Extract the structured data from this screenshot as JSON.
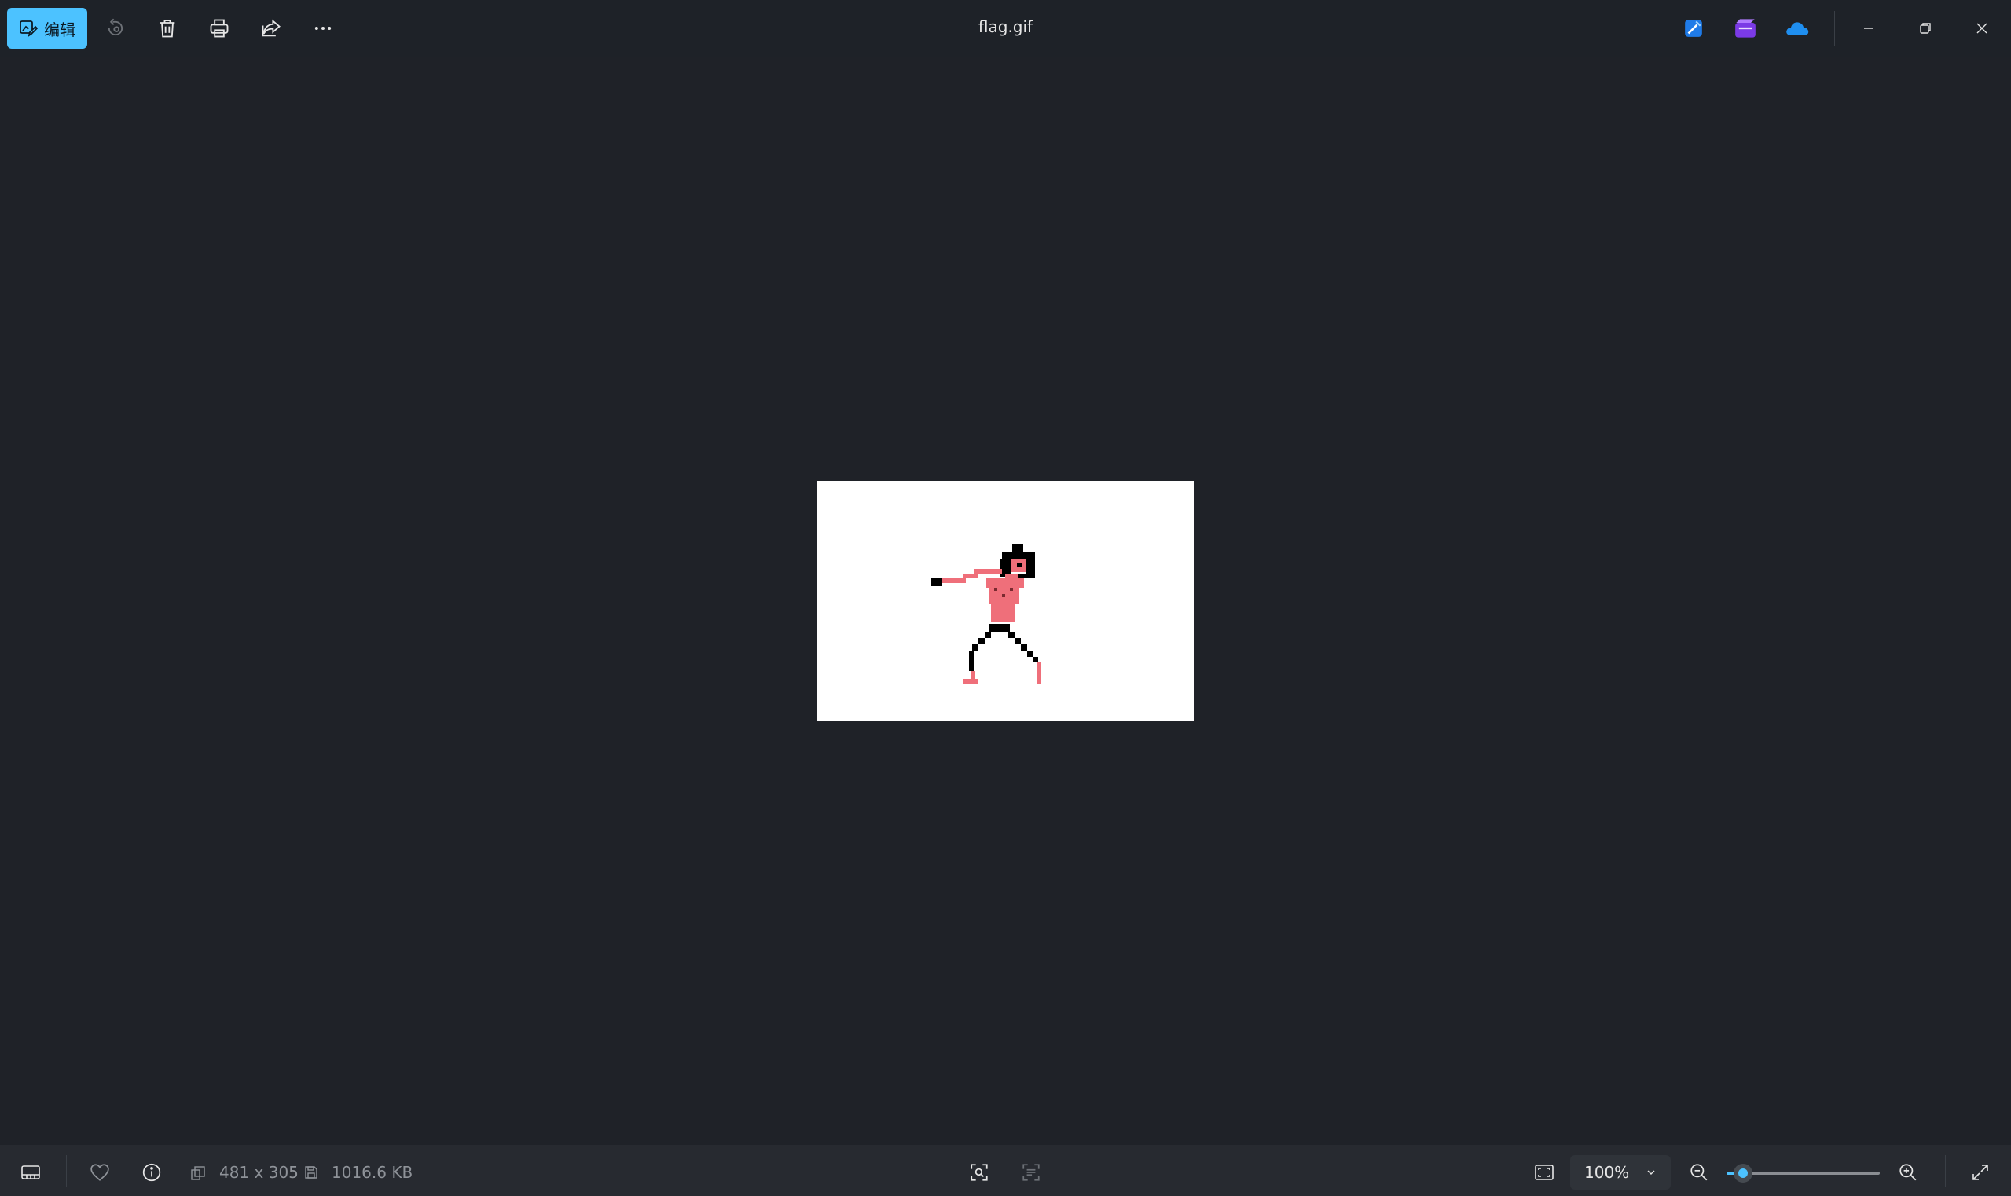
{
  "toolbar": {
    "edit_label": "编辑",
    "file_title": "flag.gif"
  },
  "status": {
    "dimensions": "481 x 305",
    "file_size": "1016.6 KB",
    "zoom_level": "100%",
    "zoom_fraction": 0.11
  },
  "icons": {
    "edit": "edit-image-icon",
    "rotate": "rotate-icon",
    "delete": "trash-icon",
    "print": "print-icon",
    "share": "share-icon",
    "more": "more-icon",
    "designer": "designer-app-icon",
    "clipchamp": "clipchamp-app-icon",
    "onedrive": "onedrive-icon",
    "filmstrip": "filmstrip-icon",
    "favorite": "heart-icon",
    "info": "info-icon",
    "visual_search": "visual-search-icon",
    "text_scan": "text-scan-icon",
    "fit": "fit-to-window-icon",
    "zoom_out": "zoom-out-icon",
    "zoom_in": "zoom-in-icon",
    "fullscreen": "fullscreen-icon"
  },
  "colors": {
    "accent": "#4cc2ff",
    "background": "#1f2228",
    "figure_pink": "#ef6f7a"
  }
}
